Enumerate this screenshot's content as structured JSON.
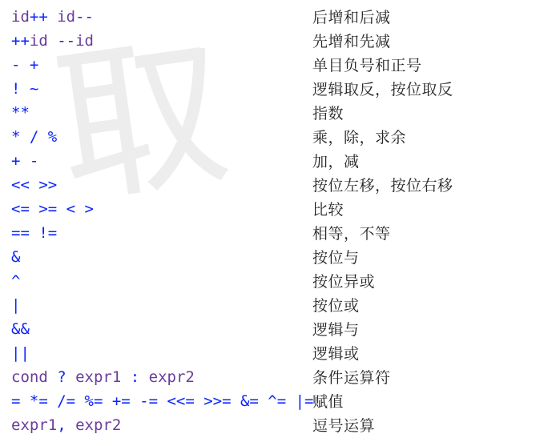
{
  "watermark": "取",
  "rows": [
    {
      "tokens": [
        {
          "t": "id",
          "cls": "id"
        },
        {
          "t": "++ ",
          "cls": "op"
        },
        {
          "t": "id",
          "cls": "id"
        },
        {
          "t": "--",
          "cls": "op"
        }
      ],
      "desc": "后增和后减"
    },
    {
      "tokens": [
        {
          "t": "++",
          "cls": "op"
        },
        {
          "t": "id ",
          "cls": "id"
        },
        {
          "t": "--",
          "cls": "op"
        },
        {
          "t": "id",
          "cls": "id"
        }
      ],
      "desc": "先增和先减"
    },
    {
      "tokens": [
        {
          "t": "- +",
          "cls": "op"
        }
      ],
      "desc": "单目负号和正号"
    },
    {
      "tokens": [
        {
          "t": "! ~",
          "cls": "op"
        }
      ],
      "desc": "逻辑取反，按位取反"
    },
    {
      "tokens": [
        {
          "t": "**",
          "cls": "op"
        }
      ],
      "desc": "指数"
    },
    {
      "tokens": [
        {
          "t": "* / %",
          "cls": "op"
        }
      ],
      "desc": "乘，除，求余"
    },
    {
      "tokens": [
        {
          "t": "+ -",
          "cls": "op"
        }
      ],
      "desc": "加，减"
    },
    {
      "tokens": [
        {
          "t": "<< >>",
          "cls": "op"
        }
      ],
      "desc": "按位左移，按位右移"
    },
    {
      "tokens": [
        {
          "t": "<= >= < >",
          "cls": "op"
        }
      ],
      "desc": "比较"
    },
    {
      "tokens": [
        {
          "t": "== !=",
          "cls": "op"
        }
      ],
      "desc": "相等，不等"
    },
    {
      "tokens": [
        {
          "t": "&",
          "cls": "op"
        }
      ],
      "desc": "按位与"
    },
    {
      "tokens": [
        {
          "t": "^",
          "cls": "op"
        }
      ],
      "desc": "按位异或"
    },
    {
      "tokens": [
        {
          "t": "|",
          "cls": "op"
        }
      ],
      "desc": "按位或"
    },
    {
      "tokens": [
        {
          "t": "&&",
          "cls": "op"
        }
      ],
      "desc": "逻辑与"
    },
    {
      "tokens": [
        {
          "t": "||",
          "cls": "op"
        }
      ],
      "desc": "逻辑或"
    },
    {
      "tokens": [
        {
          "t": "cond ",
          "cls": "id"
        },
        {
          "t": "? ",
          "cls": "op"
        },
        {
          "t": "expr1 ",
          "cls": "id"
        },
        {
          "t": ": ",
          "cls": "op"
        },
        {
          "t": "expr2",
          "cls": "id"
        }
      ],
      "desc": "条件运算符"
    },
    {
      "tokens": [
        {
          "t": "= *= /= %= += -= <<= >>= &= ^= |=",
          "cls": "op"
        }
      ],
      "desc": "赋值"
    },
    {
      "tokens": [
        {
          "t": "expr1",
          "cls": "id"
        },
        {
          "t": ", ",
          "cls": "op"
        },
        {
          "t": "expr2",
          "cls": "id"
        }
      ],
      "desc": "逗号运算"
    }
  ]
}
